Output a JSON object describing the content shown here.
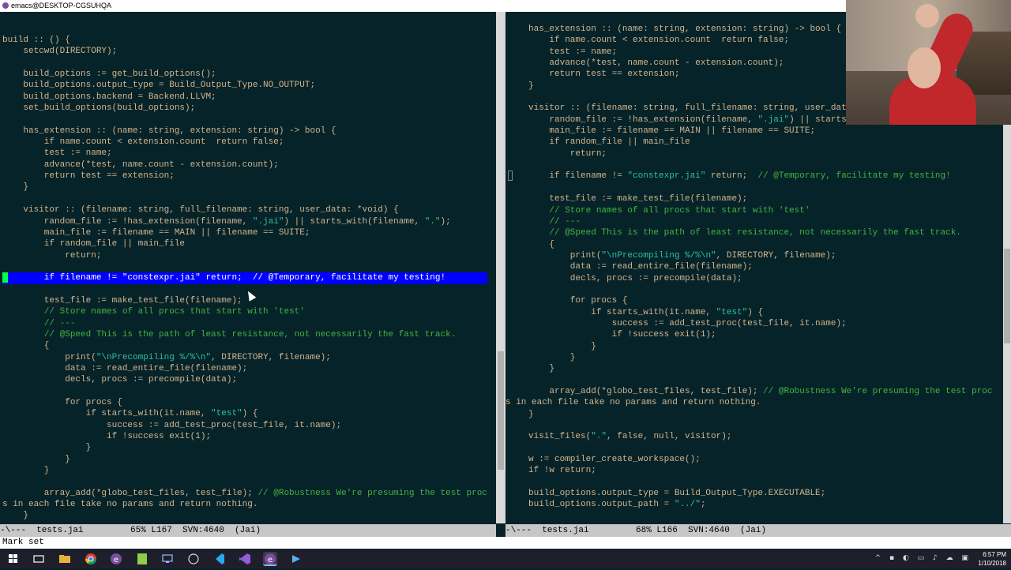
{
  "window": {
    "title": "emacs@DESKTOP-CGSUHQA"
  },
  "left_pane": {
    "lines": [
      {
        "t": "build :: () {"
      },
      {
        "t": "    setcwd(DIRECTORY);"
      },
      {
        "t": ""
      },
      {
        "t": "    build_options := get_build_options();"
      },
      {
        "t": "    build_options.output_type = Build_Output_Type.NO_OUTPUT;"
      },
      {
        "t": "    build_options.backend = Backend.LLVM;"
      },
      {
        "t": "    set_build_options(build_options);"
      },
      {
        "t": ""
      },
      {
        "t": "    has_extension :: (name: string, extension: string) -> bool {"
      },
      {
        "t": "        if name.count < extension.count  return false;"
      },
      {
        "t": "        test := name;"
      },
      {
        "t": "        advance(*test, name.count - extension.count);"
      },
      {
        "t": "        return test == extension;"
      },
      {
        "t": "    }"
      },
      {
        "t": ""
      },
      {
        "t": "    visitor :: (filename: string, full_filename: string, user_data: *void) {"
      },
      {
        "t": "        random_file := !has_extension(filename, \".jai\") || starts_with(filename, \".\");"
      },
      {
        "t": "        main_file := filename == MAIN || filename == SUITE;"
      },
      {
        "t": "        if random_file || main_file"
      },
      {
        "t": "            return;"
      },
      {
        "t": ""
      },
      {
        "t": "        if filename != \"constexpr.jai\" return;  // @Temporary, facilitate my testing!",
        "hl": true
      },
      {
        "t": ""
      },
      {
        "t": "        test_file := make_test_file(filename);"
      },
      {
        "t": "        // Store names of all procs that start with 'test'"
      },
      {
        "t": "        // ---"
      },
      {
        "t": "        // @Speed This is the path of least resistance, not necessarily the fast track."
      },
      {
        "t": "        {"
      },
      {
        "t": "            print(\"\\nPrecompiling %/%\\n\", DIRECTORY, filename);"
      },
      {
        "t": "            data := read_entire_file(filename);"
      },
      {
        "t": "            decls, procs := precompile(data);"
      },
      {
        "t": ""
      },
      {
        "t": "            for procs {"
      },
      {
        "t": "                if starts_with(it.name, \"test\") {"
      },
      {
        "t": "                    success := add_test_proc(test_file, it.name);"
      },
      {
        "t": "                    if !success exit(1);"
      },
      {
        "t": "                }"
      },
      {
        "t": "            }"
      },
      {
        "t": "        }"
      },
      {
        "t": ""
      },
      {
        "t": "        array_add(*globo_test_files, test_file); // @Robustness We're presuming the test proc"
      },
      {
        "t": "s in each file take no params and return nothing."
      },
      {
        "t": "    }"
      }
    ]
  },
  "right_pane": {
    "lines": [
      {
        "t": "has_extension :: (name: string, extension: string) -> bool {"
      },
      {
        "t": "    if name.count < extension.count  return false;"
      },
      {
        "t": "    test := name;"
      },
      {
        "t": "    advance(*test, name.count - extension.count);"
      },
      {
        "t": "    return test == extension;"
      },
      {
        "t": "}"
      },
      {
        "t": ""
      },
      {
        "t": "visitor :: (filename: string, full_filename: string, user_data: *void) {"
      },
      {
        "t": "    random_file := !has_extension(filename, \".jai\") || starts_with(filename, \".\");"
      },
      {
        "t": "    main_file := filename == MAIN || filename == SUITE;"
      },
      {
        "t": "    if random_file || main_file"
      },
      {
        "t": "        return;"
      },
      {
        "t": ""
      },
      {
        "t": "    if filename != \"constexpr.jai\" return;  // @Temporary, facilitate my testing!"
      },
      {
        "t": ""
      },
      {
        "t": "    test_file := make_test_file(filename);"
      },
      {
        "t": "    // Store names of all procs that start with 'test'"
      },
      {
        "t": "    // ---"
      },
      {
        "t": "    // @Speed This is the path of least resistance, not necessarily the fast track."
      },
      {
        "t": "    {"
      },
      {
        "t": "        print(\"\\nPrecompiling %/%\\n\", DIRECTORY, filename);"
      },
      {
        "t": "        data := read_entire_file(filename);"
      },
      {
        "t": "        decls, procs := precompile(data);"
      },
      {
        "t": ""
      },
      {
        "t": "        for procs {"
      },
      {
        "t": "            if starts_with(it.name, \"test\") {"
      },
      {
        "t": "                success := add_test_proc(test_file, it.name);"
      },
      {
        "t": "                if !success exit(1);"
      },
      {
        "t": "            }"
      },
      {
        "t": "        }"
      },
      {
        "t": "    }"
      },
      {
        "t": ""
      },
      {
        "t": "    array_add(*globo_test_files, test_file); // @Robustness We're presuming the test proc"
      },
      {
        "t": "s in each file take no params and return nothing.",
        "wrap": true
      },
      {
        "t": "}"
      },
      {
        "t": ""
      },
      {
        "t": "visit_files(\".\", false, null, visitor);"
      },
      {
        "t": ""
      },
      {
        "t": "w := compiler_create_workspace();"
      },
      {
        "t": "if !w return;"
      },
      {
        "t": ""
      },
      {
        "t": "build_options.output_type = Build_Output_Type.EXECUTABLE;"
      },
      {
        "t": "build_options.output_path = \"../\";"
      }
    ]
  },
  "modeline_left": "-\\---  tests.jai         65% L167  SVN:4640  (Jai)",
  "modeline_right": "-\\---  tests.jai         68% L166  SVN:4640  (Jai)",
  "minibuffer": "Mark set",
  "tray": {
    "time": "6:57 PM",
    "date": "1/10/2018"
  },
  "taskbar_icons": [
    "windows-start-icon",
    "task-view-icon",
    "file-explorer-icon",
    "chrome-icon",
    "emacs-icon",
    "notepad-plus-icon",
    "remote-desktop-icon",
    "app-icon",
    "vscode-icon",
    "visual-studio-icon",
    "emacs-active-icon",
    "debugger-icon"
  ],
  "colors": {
    "background": "#062329",
    "text": "#d3b58d",
    "string": "#2ec09c",
    "comment": "#44b340",
    "highlight": "#0000ff"
  }
}
